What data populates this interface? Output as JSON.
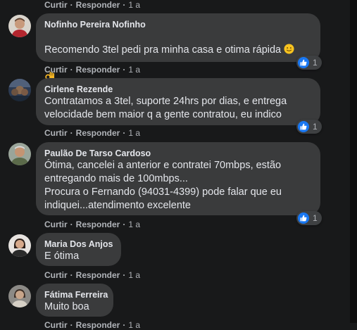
{
  "top_actions": {
    "like": "Curtir",
    "reply": "Responder",
    "sep": "·",
    "time": "1 a"
  },
  "comments": [
    {
      "author": "Nofinho Pereira Nofinho",
      "text_lines": [
        "Recomendo 3tel pedi pra minha casa e otima rápida"
      ],
      "emojis": [
        "slightly-smiling-face-icon",
        "ok-hand-icon"
      ],
      "like_label": "Curtir",
      "reply_label": "Responder",
      "sep": "·",
      "time": "1 a",
      "reaction_count": "1"
    },
    {
      "author": "Cirlene Rezende",
      "text_lines": [
        "Contratamos a 3tel, suporte 24hrs por dias, e entrega",
        "velocidade bem maior q a gente contratou, eu indico"
      ],
      "like_label": "Curtir",
      "reply_label": "Responder",
      "sep": "·",
      "time": "1 a",
      "reaction_count": "1"
    },
    {
      "author": "Paulão De Tarso Cardoso",
      "text_lines": [
        "Ótima, cancelei a anterior e contratei 70mbps, estão",
        "entregando mais de 100mbps...",
        "Procura o Fernando (94031-4399) pode falar que eu",
        "indiquei...atendimento excelente"
      ],
      "like_label": "Curtir",
      "reply_label": "Responder",
      "sep": "·",
      "time": "1 a",
      "reaction_count": "1"
    },
    {
      "author": "Maria Dos Anjos",
      "text_lines": [
        "E ótima"
      ],
      "like_label": "Curtir",
      "reply_label": "Responder",
      "sep": "·",
      "time": "1 a"
    },
    {
      "author": "Fátima Ferreira",
      "text_lines": [
        "Muito boa"
      ],
      "like_label": "Curtir",
      "reply_label": "Responder",
      "sep": "·",
      "time": "1 a"
    }
  ],
  "colors": {
    "background": "#18191a",
    "bubble": "#3a3b3c",
    "text": "#e4e6eb",
    "secondary_text": "#b0b3b8",
    "like_blue": "#1877f2"
  }
}
